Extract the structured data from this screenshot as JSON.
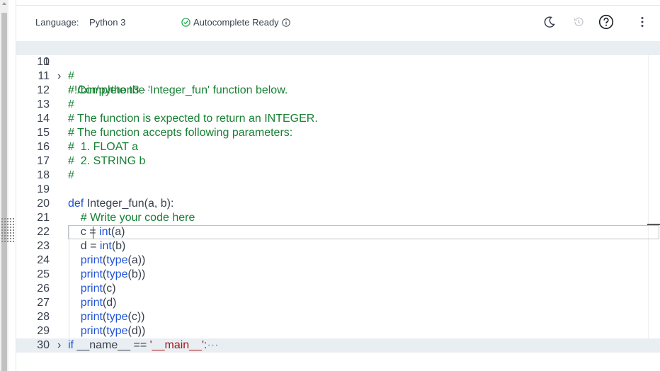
{
  "toolbar": {
    "language_label": "Language:",
    "language_value": "Python 3",
    "autocomplete_label": "Autocomplete Ready",
    "icons": [
      "theme-moon-icon",
      "history-icon",
      "help-icon",
      "more-vertical-icon"
    ]
  },
  "editor": {
    "lines": [
      {
        "num": "1",
        "fold": "›",
        "html_key": "l1",
        "text": "#!/bin/python3",
        "folded": true
      },
      {
        "num": "10",
        "text": ""
      },
      {
        "num": "11",
        "text": "#"
      },
      {
        "num": "12",
        "text": "# Complete the 'Integer_fun' function below."
      },
      {
        "num": "13",
        "text": "#"
      },
      {
        "num": "14",
        "text": "# The function is expected to return an INTEGER."
      },
      {
        "num": "15",
        "text": "# The function accepts following parameters:"
      },
      {
        "num": "16",
        "text": "#  1. FLOAT a"
      },
      {
        "num": "17",
        "text": "#  2. STRING b"
      },
      {
        "num": "18",
        "text": "#"
      },
      {
        "num": "19",
        "text": ""
      },
      {
        "num": "20",
        "text": "def Integer_fun(a, b):"
      },
      {
        "num": "21",
        "text": "    # Write your code here"
      },
      {
        "num": "22",
        "text": "    c = int(a)"
      },
      {
        "num": "23",
        "text": "    d = int(b)"
      },
      {
        "num": "24",
        "text": "    print(type(a))"
      },
      {
        "num": "25",
        "text": "    print(type(b))"
      },
      {
        "num": "26",
        "text": "    print(c)"
      },
      {
        "num": "27",
        "text": "    print(d)"
      },
      {
        "num": "28",
        "text": "    print(type(c))"
      },
      {
        "num": "29",
        "text": "    print(type(d))"
      },
      {
        "num": "30",
        "text": "if __name__ == '__main__':",
        "folded": true
      }
    ],
    "ellipsis": "···"
  }
}
